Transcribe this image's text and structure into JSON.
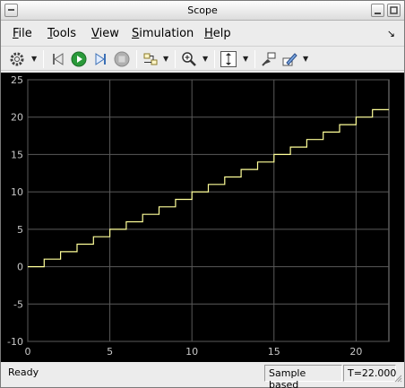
{
  "window": {
    "title": "Scope"
  },
  "menu": {
    "items": [
      {
        "label": "File",
        "mnemonic": "F",
        "rest": "ile"
      },
      {
        "label": "Tools",
        "mnemonic": "T",
        "rest": "ools"
      },
      {
        "label": "View",
        "mnemonic": "V",
        "rest": "iew"
      },
      {
        "label": "Simulation",
        "mnemonic": "S",
        "rest": "imulation"
      },
      {
        "label": "Help",
        "mnemonic": "H",
        "rest": "elp"
      }
    ]
  },
  "toolbar": {
    "icons": [
      "settings-icon",
      "step-back-icon",
      "run-icon",
      "step-forward-icon",
      "stop-icon",
      "signal-config-icon",
      "zoom-in-icon",
      "autoscale-icon",
      "highlight-block-icon",
      "style-icon"
    ]
  },
  "status": {
    "ready": "Ready",
    "mode": "Sample based",
    "time": "T=22.000"
  },
  "colors": {
    "plot_background": "#000000",
    "grid": "#5a5a5a",
    "line": "#ffff99",
    "tick_text": "#c8c8c8"
  },
  "chart_data": {
    "type": "line",
    "step": true,
    "x": [
      0,
      1,
      1,
      2,
      2,
      3,
      3,
      4,
      4,
      5,
      5,
      6,
      6,
      7,
      7,
      8,
      8,
      9,
      9,
      10,
      10,
      11,
      11,
      12,
      12,
      13,
      13,
      14,
      14,
      15,
      15,
      16,
      16,
      17,
      17,
      18,
      18,
      19,
      19,
      20,
      20,
      21,
      21,
      22
    ],
    "y": [
      0,
      0,
      1,
      1,
      2,
      2,
      3,
      3,
      4,
      4,
      5,
      5,
      6,
      6,
      7,
      7,
      8,
      8,
      9,
      9,
      10,
      10,
      11,
      11,
      12,
      12,
      13,
      13,
      14,
      14,
      15,
      15,
      16,
      16,
      17,
      17,
      18,
      18,
      19,
      19,
      20,
      20,
      21,
      21
    ],
    "xlim": [
      0,
      22
    ],
    "ylim": [
      -10,
      25
    ],
    "xticks": [
      "0",
      "5",
      "10",
      "15",
      "20"
    ],
    "yticks": [
      "-10",
      "-5",
      "0",
      "5",
      "10",
      "15",
      "20",
      "25"
    ],
    "grid": true,
    "title": "",
    "xlabel": "",
    "ylabel": ""
  }
}
